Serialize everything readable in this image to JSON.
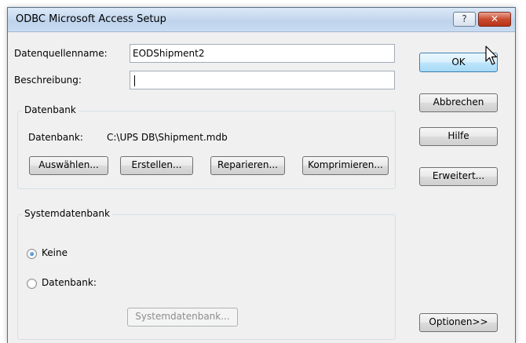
{
  "window": {
    "title": "ODBC Microsoft Access Setup",
    "help_label": "?",
    "close_label": "✕"
  },
  "form": {
    "dsn_label": "Datenquellenname:",
    "dsn_value": "EODShipment2",
    "desc_label": "Beschreibung:",
    "desc_value": ""
  },
  "database_group": {
    "title": "Datenbank",
    "db_label": "Datenbank:",
    "db_path": "C:\\UPS DB\\Shipment.mdb",
    "buttons": [
      "Auswählen...",
      "Erstellen...",
      "Reparieren...",
      "Komprimieren..."
    ]
  },
  "system_group": {
    "title": "Systemdatenbank",
    "radio_none": "Keine",
    "radio_db": "Datenbank:",
    "selected": "Keine",
    "sysdb_button": "Systemdatenbank..."
  },
  "side_buttons": {
    "ok": "OK",
    "cancel": "Abbrechen",
    "help": "Hilfe",
    "advanced": "Erweitert...",
    "options": "Optionen>>"
  }
}
